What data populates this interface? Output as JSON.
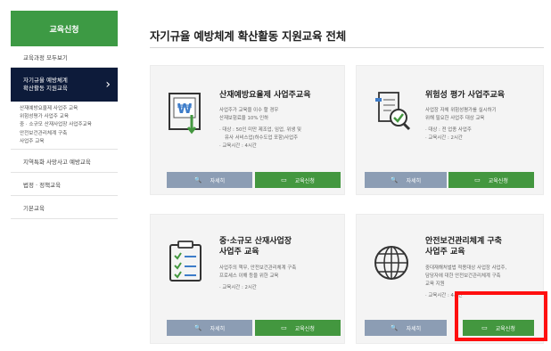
{
  "sidebar": {
    "header": "교육신청",
    "items": [
      {
        "label": "교육과정 모두보기"
      },
      {
        "label": "자기규율 예방체계\n확산활동 지원교육"
      },
      {
        "label": "지역특화 사망사고 예방교육"
      },
      {
        "label": "법정 · 정책교육"
      },
      {
        "label": "기본교육"
      }
    ],
    "subitems": [
      "산재예방요율제 사업주 교육",
      "위험성평가 사업주 교육",
      "중 · 소규모 산재사업장 사업주교육",
      "안전보건관리체계 구축",
      "사업주 교육"
    ],
    "chevron": "›"
  },
  "main": {
    "title": "자기규율 예방체계 확산활동 지원교육 전체"
  },
  "cards": [
    {
      "title": "산재예방요율제 사업주교육",
      "icon": "won-document-icon",
      "desc": [
        "사업주가 교육을 이수 할 경우",
        "산재보험료율 10% 인하",
        "· 대상 : 50인 미만 제조업, 임업, 위생 및",
        "유사 서비스업(하수도업 포함)사업주",
        "· 교육시간 : 4시간"
      ],
      "detail": "자세히",
      "apply": "교육신청"
    },
    {
      "title": "위험성 평가 사업주교육",
      "icon": "checklist-magnifier-icon",
      "desc": [
        "사업장 자체 위험성평가를 실시하기",
        "위해 필요한 사업주 대상 교육",
        "· 대상 : 전 업종 사업주",
        "· 교육시간 : 2시간"
      ],
      "detail": "자세히",
      "apply": "교육신청"
    },
    {
      "title": "중·소규모 산재사업장",
      "title2": "사업주 교육",
      "icon": "clipboard-checklist-icon",
      "desc": [
        "사업주의 책무, 안전보건관리체계 구축",
        "프로세스 이해 등을 위한 교육",
        "· 교육시간 : 2시간"
      ],
      "detail": "자세히",
      "apply": "교육신청"
    },
    {
      "title": "안전보건관리체계 구축",
      "title2": "사업주 교육",
      "icon": "globe-icon",
      "desc": [
        "중대재해처벌법 적용대상 사업장 사업주,",
        "담당자에 대한 안전보건관리체계 구축",
        "교육 지원",
        "· 교육시간 : 4시간"
      ],
      "detail": "자세히",
      "apply": "교육신청"
    }
  ],
  "colors": {
    "green": "#43973f",
    "navy": "#0d1b3a",
    "detail_btn": "#8c9db4",
    "highlight": "#ff0f0f"
  }
}
